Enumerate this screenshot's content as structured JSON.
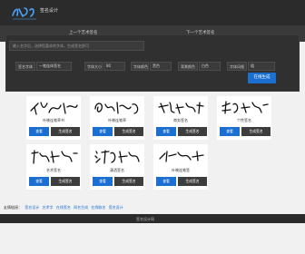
{
  "header": {
    "logo_text": "签名网",
    "site_title": "签名设计"
  },
  "nav": {
    "prev": "上一个艺术签名",
    "next": "下一个艺术签名"
  },
  "form": {
    "name_placeholder": "输入名字后，选择您喜欢的字体，生成签名即可",
    "font_label": "签名字体",
    "font_value": "一笔连体签名",
    "size_label": "字体大小",
    "size_value": "80",
    "color_label": "字体颜色",
    "color_value": "黑色",
    "bg_label": "背景颜色",
    "bg_value": "白色",
    "style_label": "字体风格",
    "style_value": "粗",
    "submit_label": "在线生成"
  },
  "cards": [
    {
      "name": "叶晓连笔草书",
      "view_label": "查看",
      "make_label": "生成签名"
    },
    {
      "name": "叶晓连笔草",
      "view_label": "查看",
      "make_label": "生成签名"
    },
    {
      "name": "商务签名",
      "view_label": "查看",
      "make_label": "生成签名"
    },
    {
      "name": "个性签名",
      "view_label": "查看",
      "make_label": "生成签名"
    },
    {
      "name": "艺术签名",
      "view_label": "查看",
      "make_label": "生成签名"
    },
    {
      "name": "潇洒签名",
      "view_label": "查看",
      "make_label": "生成签名"
    },
    {
      "name": "叶晓连笔签",
      "view_label": "查看",
      "make_label": "生成签名"
    }
  ],
  "footer": {
    "friend_label": "友情链接：",
    "links": [
      "签名设计",
      "艺术字",
      "在线签名",
      "网名生成",
      "在线取名",
      "签名设计"
    ],
    "copyright": "签名设计网"
  },
  "colors": {
    "accent": "#1a6fd1",
    "header_bg": "#2b2b2b",
    "page_bg": "#f1f1f1"
  }
}
